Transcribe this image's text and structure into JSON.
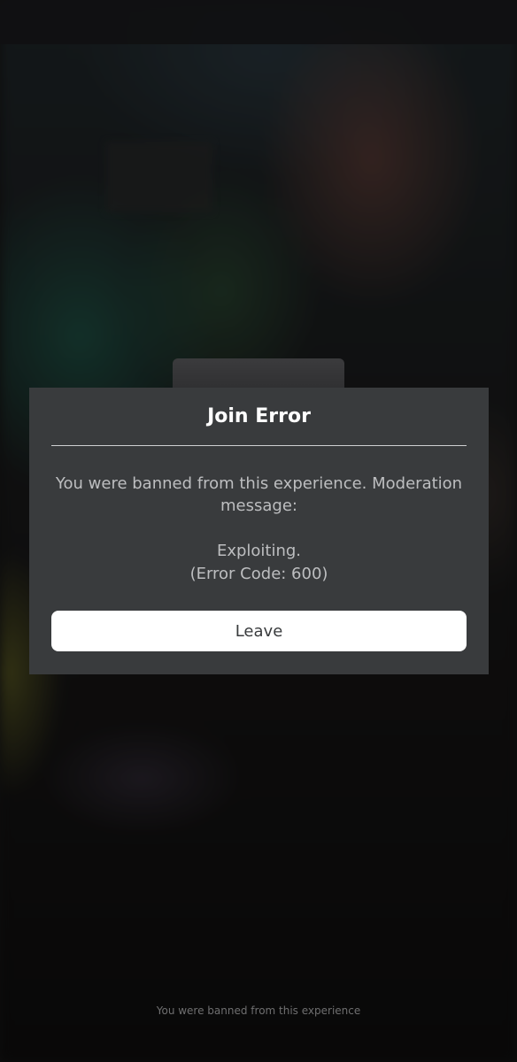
{
  "dialog": {
    "title": "Join Error",
    "message": "You were banned from this experience. Moderation message:",
    "reason": "Exploiting.",
    "error_code": "(Error Code: 600)",
    "leave_label": "Leave"
  },
  "footer": {
    "status": "You were banned from this experience"
  },
  "colors": {
    "dialog_background": "#393b3d",
    "button_background": "#ffffff",
    "title_text": "#ffffff",
    "body_text": "#bdbec0"
  }
}
